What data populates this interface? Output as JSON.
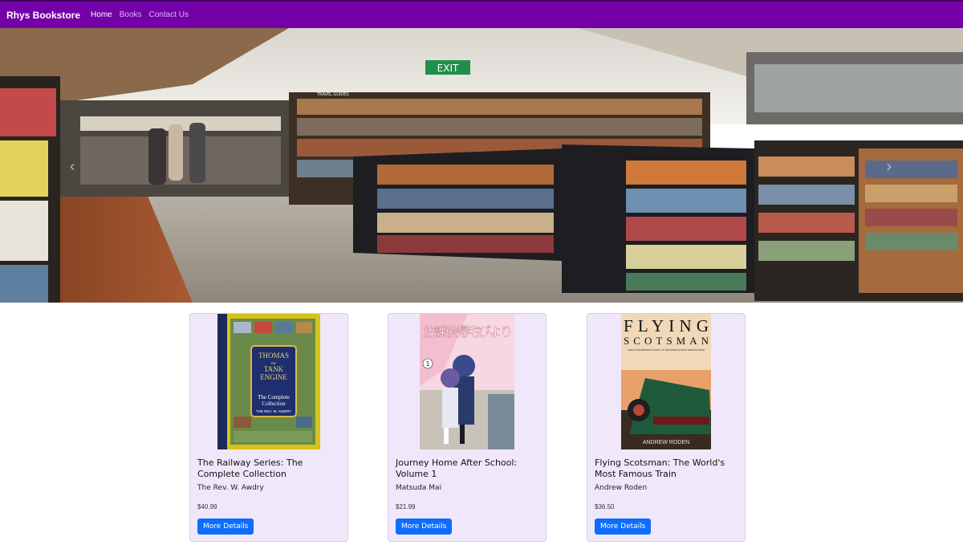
{
  "navbar": {
    "brand": "Rhys Bookstore",
    "links": [
      {
        "label": "Home",
        "active": true
      },
      {
        "label": "Books",
        "active": false
      },
      {
        "label": "Contact Us",
        "active": false
      }
    ],
    "color": "#7400a8"
  },
  "hero": {
    "sign_exit": "EXIT",
    "shelf_sign": "TRAVEL GUIDES",
    "prev_icon": "chevron-left-icon",
    "next_icon": "chevron-right-icon"
  },
  "books": [
    {
      "title": "The Railway Series: The Complete Collection",
      "author": "The Rev. W. Awdry",
      "price": "$40.99",
      "button": "More Details",
      "cover_text": {
        "line1": "THOMAS",
        "line2": "the",
        "line3": "TANK",
        "line4": "ENGINE",
        "line5": "The Complete",
        "line6": "Collection",
        "line7": "THE REV. W. AWDRY"
      }
    },
    {
      "title": "Journey Home After School: Volume 1",
      "author": "Matsuda Mai",
      "price": "$21.99",
      "button": "More Details",
      "cover_text": {
        "line1": "放課後帰宅びより",
        "line2": "1"
      }
    },
    {
      "title": "Flying Scotsman: The World's Most Famous Train",
      "author": "Andrew Roden",
      "price": "$36.50",
      "button": "More Details",
      "cover_text": {
        "line1": "FLYING",
        "line2": "SCOTSMAN",
        "line3": "THE EXTRAORDINARY STORY OF THE WORLD'S MOST FAMOUS TRAIN",
        "line4": "ANDREW RODEN"
      }
    }
  ],
  "colors": {
    "button": "#0d6efd",
    "card_bg": "#f1e7fb"
  }
}
